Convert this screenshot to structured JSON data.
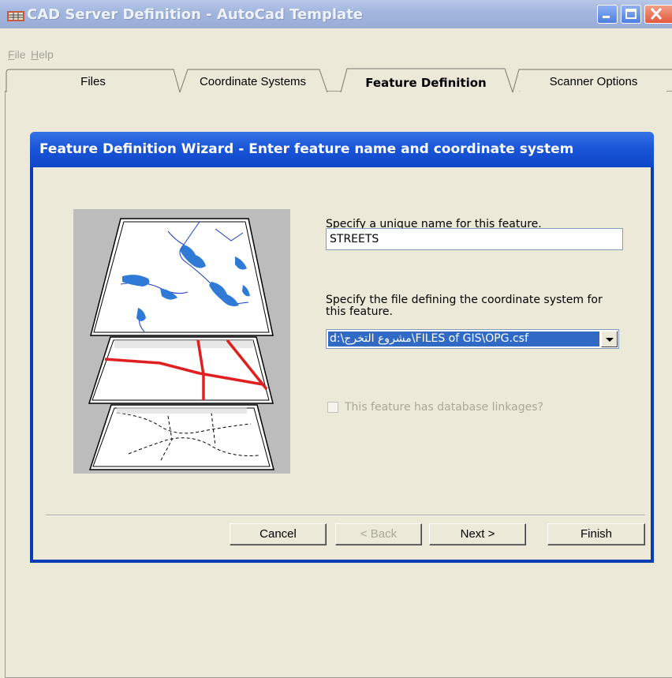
{
  "window": {
    "title": "CAD Server Definition - AutoCad Template",
    "icon": "app-window-icon"
  },
  "menu": {
    "items": [
      {
        "label": "File",
        "accel": "F"
      },
      {
        "label": "Help",
        "accel": "H"
      }
    ]
  },
  "tabs": [
    {
      "label": "Files",
      "active": false
    },
    {
      "label": "Coordinate Systems",
      "active": false
    },
    {
      "label": "Feature Definition",
      "active": true
    },
    {
      "label": "Scanner Options",
      "active": false
    }
  ],
  "wizard": {
    "title": "Feature Definition Wizard - Enter feature name and coordinate system",
    "name_label": "Specify a unique name for this feature.",
    "name_value": "STREETS",
    "cs_label": "Specify the file defining the coordinate system for this feature.",
    "cs_value": "d:\\مشروع التخرج\\FILES of GIS\\OPG.csf",
    "db_checkbox_label": "This feature has database linkages?",
    "db_checkbox_checked": false,
    "db_checkbox_enabled": false,
    "buttons": {
      "cancel": "Cancel",
      "back": "< Back",
      "next": "Next >",
      "finish": "Finish"
    }
  },
  "colors": {
    "wizard_header": "#1a56d8",
    "selection": "#316ac5",
    "map_water": "#2f7ad6",
    "map_roads": "#e02020"
  }
}
